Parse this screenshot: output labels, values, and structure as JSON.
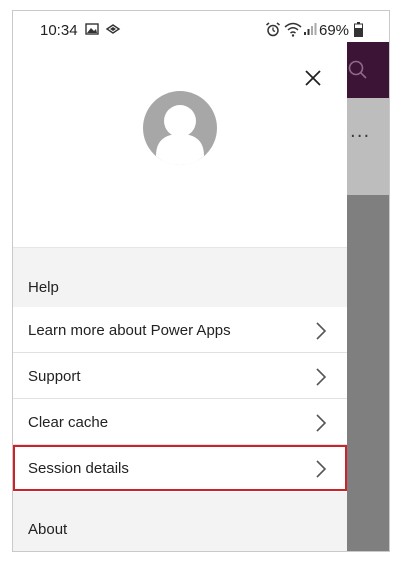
{
  "status_bar": {
    "time": "10:34",
    "battery_percent": "69%",
    "icons": [
      "image-icon",
      "cast-icon",
      "alarm-icon",
      "wifi-icon",
      "signal-icon",
      "battery-icon"
    ]
  },
  "drawer": {
    "close_icon": "close-icon",
    "avatar_icon": "user-avatar-icon",
    "help_header": "Help",
    "menu_items": [
      {
        "label": "Learn more about Power Apps",
        "icon": "chevron-right-icon"
      },
      {
        "label": "Support",
        "icon": "chevron-right-icon"
      },
      {
        "label": "Clear cache",
        "icon": "chevron-right-icon"
      },
      {
        "label": "Session details",
        "icon": "chevron-right-icon",
        "highlighted": true
      }
    ],
    "about_header": "About"
  },
  "background_app": {
    "header_color": "#3b1436",
    "more_label": "···"
  },
  "colors": {
    "highlight": "#cc2229",
    "section_bg": "#f3f3f3"
  }
}
